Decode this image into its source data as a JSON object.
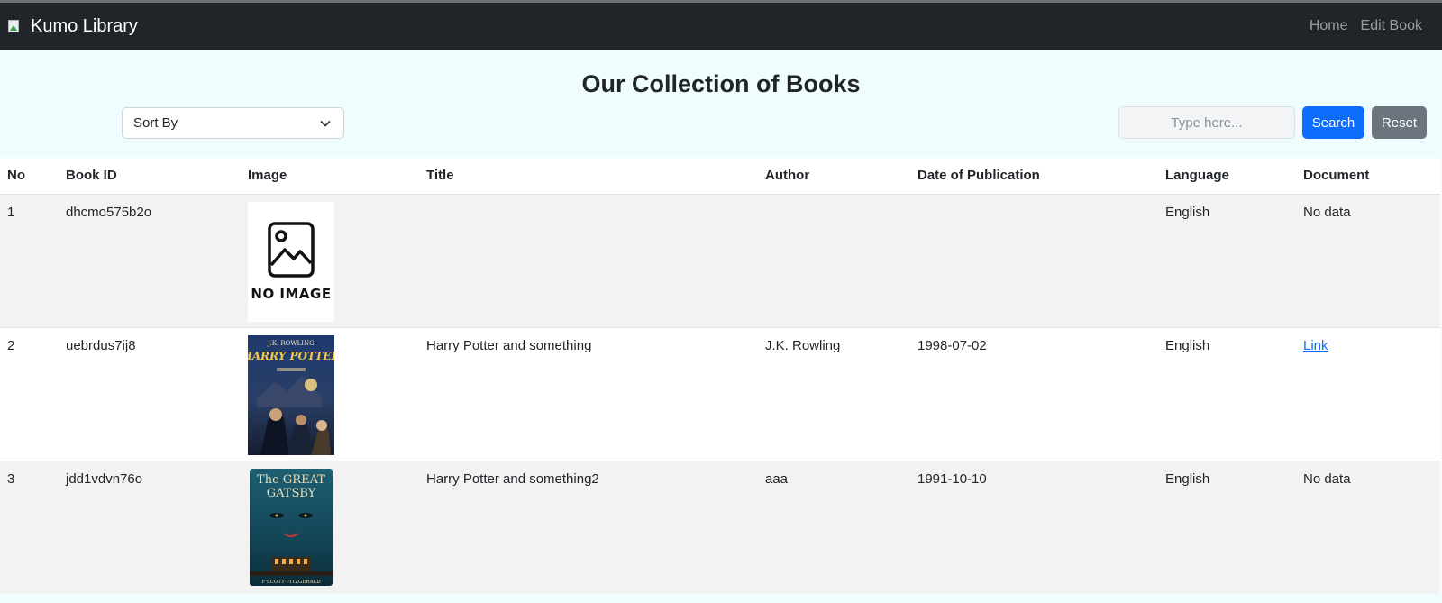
{
  "navbar": {
    "brand": "Kumo Library",
    "links": [
      "Home",
      "Edit Book"
    ]
  },
  "page": {
    "heading": "Our Collection of Books"
  },
  "controls": {
    "sort_label": "Sort By",
    "search_placeholder": "Type here...",
    "search_button": "Search",
    "reset_button": "Reset"
  },
  "table": {
    "headers": [
      "No",
      "Book ID",
      "Image",
      "Title",
      "Author",
      "Date of Publication",
      "Language",
      "Document"
    ],
    "rows": [
      {
        "no": "1",
        "book_id": "dhcmo575b2o",
        "image_label": "NO IMAGE",
        "title": "",
        "author": "",
        "date": "",
        "language": "English",
        "document": "No data"
      },
      {
        "no": "2",
        "book_id": "uebrdus7ij8",
        "image_cover": {
          "author": "J.K. ROWLING",
          "title": "HARRY POTTER"
        },
        "title": "Harry Potter and something",
        "author": "J.K. Rowling",
        "date": "1998-07-02",
        "language": "English",
        "document": "Link"
      },
      {
        "no": "3",
        "book_id": "jdd1vdvn76o",
        "image_cover": {
          "title_line1": "The GREAT",
          "title_line2": "GATSBY",
          "author": "F·SCOTT·FITZGERALD"
        },
        "title": "Harry Potter and something2",
        "author": "aaa",
        "date": "1991-10-10",
        "language": "English",
        "document": "No data"
      }
    ]
  },
  "colors": {
    "navbar": "#212529",
    "page_bg": "#f0fdff",
    "primary": "#0d6efd",
    "secondary": "#6c757d"
  }
}
